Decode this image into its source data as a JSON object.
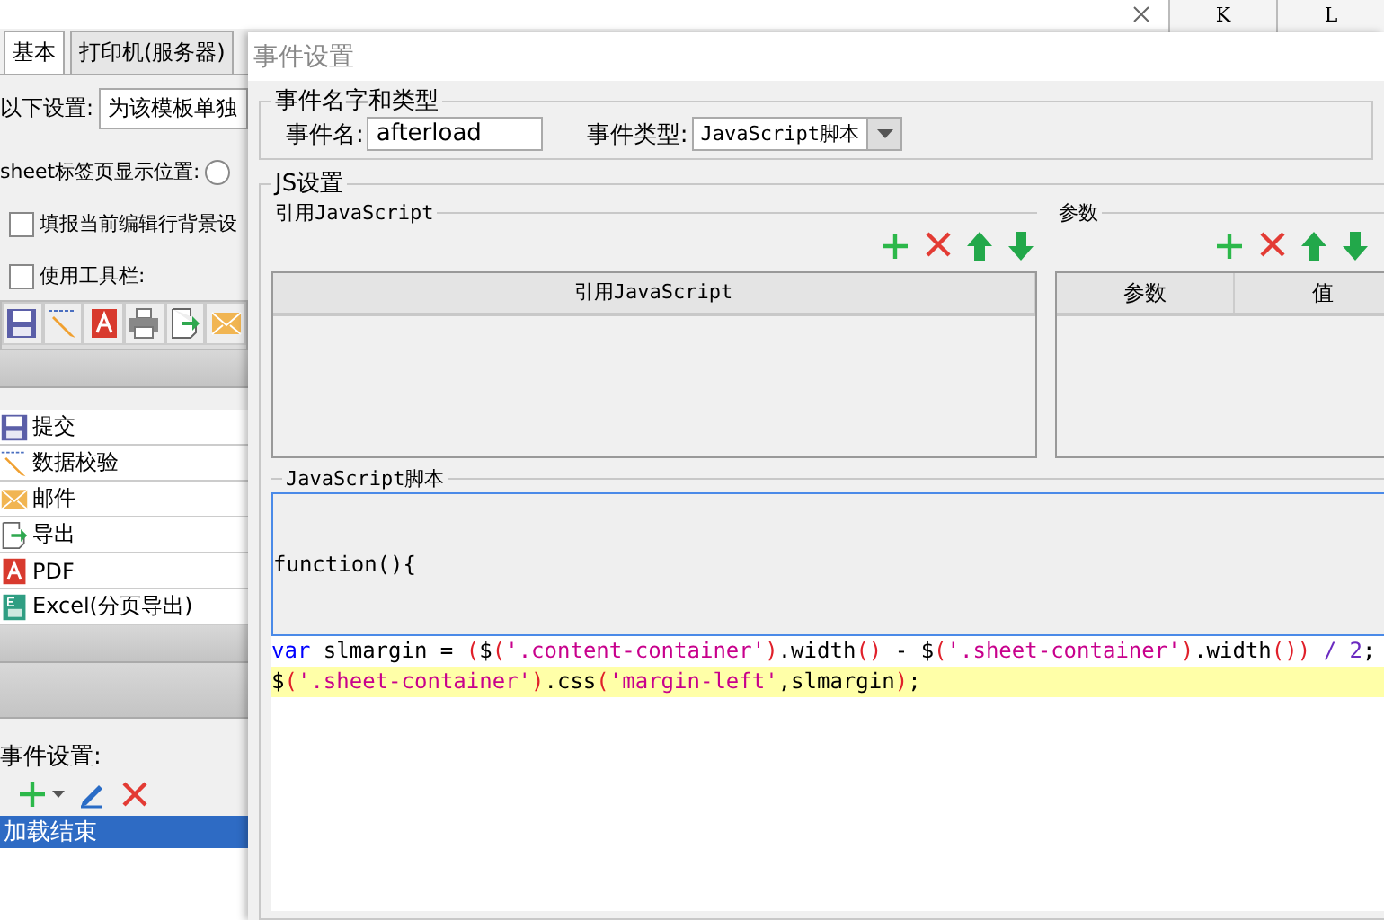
{
  "spreadsheet": {
    "columns": [
      "K",
      "L"
    ]
  },
  "left_panel": {
    "tabs": [
      {
        "label": "基本",
        "selected": true
      },
      {
        "label": "打印机(服务器)",
        "selected": false
      }
    ],
    "setting_label": "以下设置:",
    "setting_value": "为该模板单独",
    "sheet_position_label": "sheet标签页显示位置:",
    "sheet_position_radio": {
      "selected": false
    },
    "checkboxes": [
      {
        "label": "填报当前编辑行背景设",
        "checked": false
      },
      {
        "label": "使用工具栏:",
        "checked": false
      }
    ],
    "toolbar": [
      {
        "kind": "save"
      },
      {
        "kind": "edit"
      },
      {
        "kind": "pdf"
      },
      {
        "kind": "print"
      },
      {
        "kind": "export"
      },
      {
        "kind": "mail"
      }
    ],
    "buttons": [
      {
        "kind": "save",
        "label": "提交"
      },
      {
        "kind": "edit",
        "label": "数据校验"
      },
      {
        "kind": "mail",
        "label": "邮件"
      },
      {
        "kind": "export",
        "label": "导出"
      },
      {
        "kind": "pdf",
        "label": "PDF"
      },
      {
        "kind": "excel",
        "label": "Excel(分页导出)"
      }
    ],
    "events_label": "事件设置:",
    "event_actions": [
      {
        "kind": "add"
      },
      {
        "kind": "edit"
      },
      {
        "kind": "delete"
      }
    ],
    "events": [
      {
        "label": "加载结束",
        "selected": true
      }
    ]
  },
  "dialog": {
    "title": "事件设置",
    "name_type_group": {
      "title": "事件名字和类型",
      "name_label": "事件名:",
      "name_value": "afterload",
      "type_label": "事件类型:",
      "type_value": "JavaScript脚本"
    },
    "js_group": {
      "title": "JS设置",
      "references": {
        "title": "引用JavaScript",
        "actions": [
          {
            "kind": "add"
          },
          {
            "kind": "delete"
          },
          {
            "kind": "up"
          },
          {
            "kind": "down"
          }
        ],
        "columns": [
          "引用JavaScript"
        ]
      },
      "params": {
        "title": "参数",
        "actions": [
          {
            "kind": "add"
          },
          {
            "kind": "delete"
          },
          {
            "kind": "up"
          },
          {
            "kind": "down"
          }
        ],
        "columns": [
          "参数",
          "值"
        ]
      },
      "script": {
        "title": "JavaScript脚本",
        "header_line": "function(){",
        "lines": [
          {
            "highlighted": false,
            "tokens": [
              {
                "kind": "keyword",
                "text": "var"
              },
              {
                "kind": "plain",
                "text": " slmargin = "
              },
              {
                "kind": "paren",
                "text": "("
              },
              {
                "kind": "plain",
                "text": "$"
              },
              {
                "kind": "paren",
                "text": "("
              },
              {
                "kind": "string",
                "text": "'.content-container'"
              },
              {
                "kind": "paren",
                "text": ")"
              },
              {
                "kind": "plain",
                "text": ".width"
              },
              {
                "kind": "paren",
                "text": "()"
              },
              {
                "kind": "plain",
                "text": " - $"
              },
              {
                "kind": "paren",
                "text": "("
              },
              {
                "kind": "string",
                "text": "'.sheet-container'"
              },
              {
                "kind": "paren",
                "text": ")"
              },
              {
                "kind": "plain",
                "text": ".width"
              },
              {
                "kind": "paren",
                "text": "())"
              },
              {
                "kind": "number",
                "text": " / 2"
              },
              {
                "kind": "plain",
                "text": ";"
              }
            ]
          },
          {
            "highlighted": true,
            "tokens": [
              {
                "kind": "plain",
                "text": "$"
              },
              {
                "kind": "paren",
                "text": "("
              },
              {
                "kind": "string",
                "text": "'.sheet-container'"
              },
              {
                "kind": "paren",
                "text": ")"
              },
              {
                "kind": "plain",
                "text": ".css"
              },
              {
                "kind": "paren",
                "text": "("
              },
              {
                "kind": "string",
                "text": "'margin-left'"
              },
              {
                "kind": "plain",
                "text": ",slmargin"
              },
              {
                "kind": "paren",
                "text": ")"
              },
              {
                "kind": "plain",
                "text": ";"
              }
            ]
          }
        ]
      }
    }
  }
}
